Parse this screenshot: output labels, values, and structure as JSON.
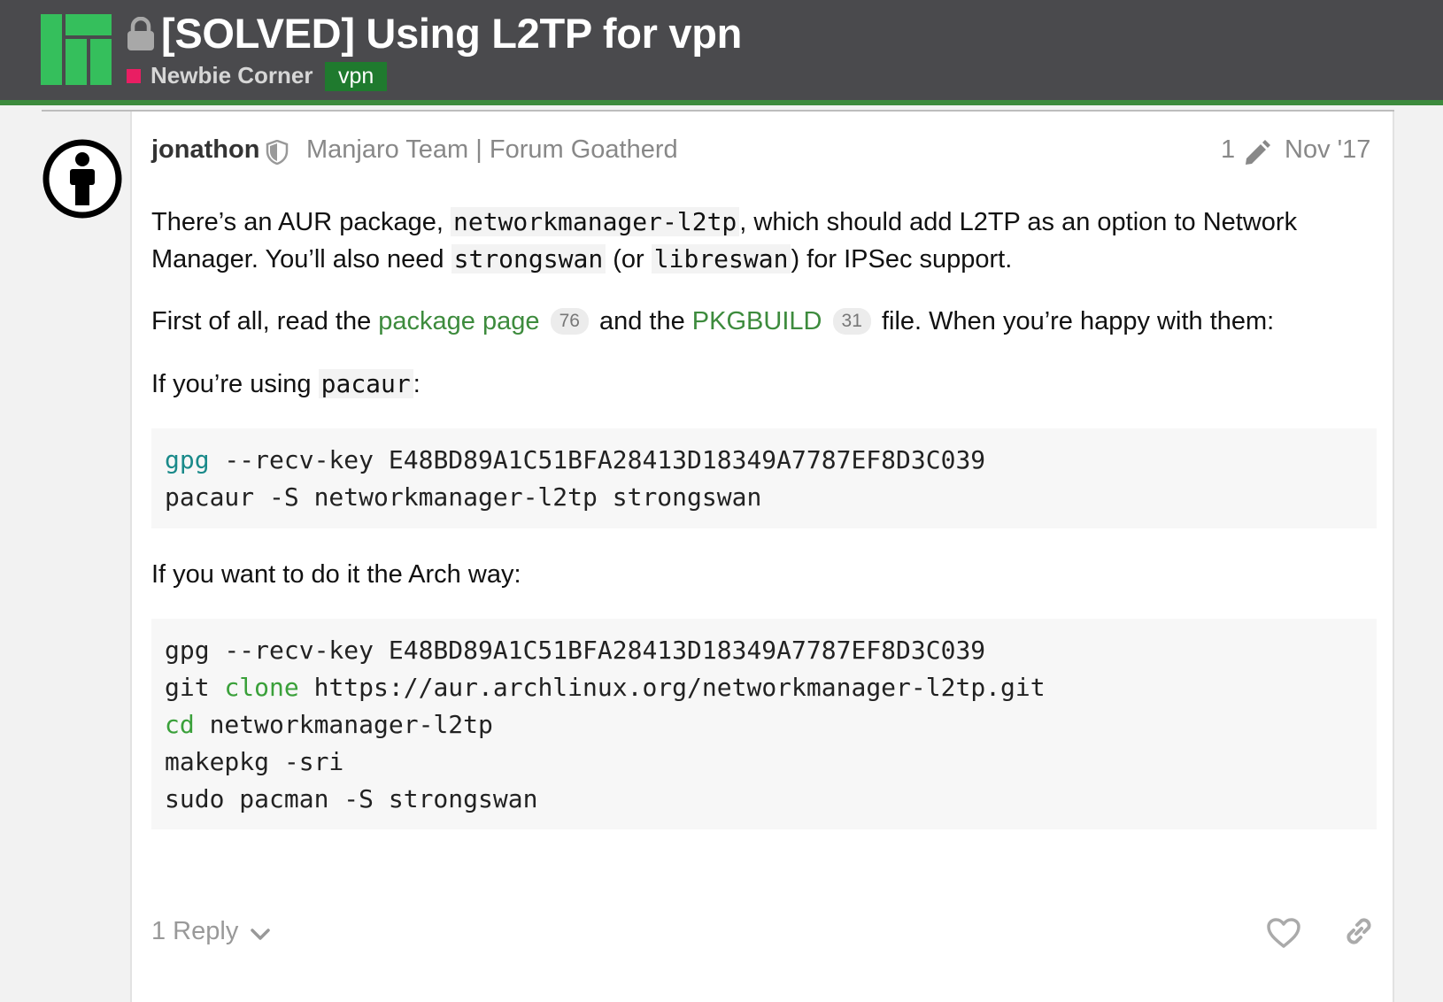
{
  "topic": {
    "title": "[SOLVED] Using L2TP for vpn",
    "category": "Newbie Corner",
    "tag": "vpn"
  },
  "colors": {
    "header_bg": "#4a4a4d",
    "accent_green": "#3d8b3d",
    "category_pink": "#e91e63",
    "tag_green": "#1f7a2e"
  },
  "post": {
    "username": "jonathon",
    "user_title": "Manjaro Team | Forum Goatherd",
    "edit_count": "1",
    "date": "Nov '17",
    "p1": {
      "t1": "There’s an AUR package, ",
      "c1": "networkmanager-l2tp",
      "t2": ", which should add L2TP as an option to Network",
      "t3": "Manager. You’ll also need ",
      "c2": "strongswan",
      "t4": " (or ",
      "c3": "libreswan",
      "t5": ") for IPSec support."
    },
    "p2": {
      "t1": "First of all, read the ",
      "link1": "package page",
      "count1": "76",
      "t2": " and the ",
      "link2": "PKGBUILD",
      "count2": "31",
      "t3": " file. When you’re happy with them:"
    },
    "p3": {
      "t1": "If you’re using ",
      "c1": "pacaur",
      "t2": ":"
    },
    "code1": {
      "l1_cmd": "gpg",
      "l1_rest": " --recv-key E48BD89A1C51BFA28413D18349A7787EF8D3C039",
      "l2": "pacaur -S networkmanager-l2tp strongswan"
    },
    "p4": "If you want to do it the Arch way:",
    "code2": {
      "l1": "gpg --recv-key E48BD89A1C51BFA28413D18349A7787EF8D3C039",
      "l2_a": "git ",
      "l2_kw": "clone",
      "l2_b": " https://aur.archlinux.org/networkmanager-l2tp.git",
      "l3_kw": "cd",
      "l3_b": " networkmanager-l2tp",
      "l4": "makepkg -sri",
      "l5": "sudo pacman -S strongswan"
    },
    "replies_label": "1 Reply"
  },
  "icons": {
    "logo": "manjaro-logo",
    "lock": "lock-icon",
    "avatar": "user-avatar-icon",
    "shield": "shield-icon",
    "pencil": "pencil-icon",
    "chevron": "chevron-down-icon",
    "heart": "heart-icon",
    "link": "link-icon"
  }
}
